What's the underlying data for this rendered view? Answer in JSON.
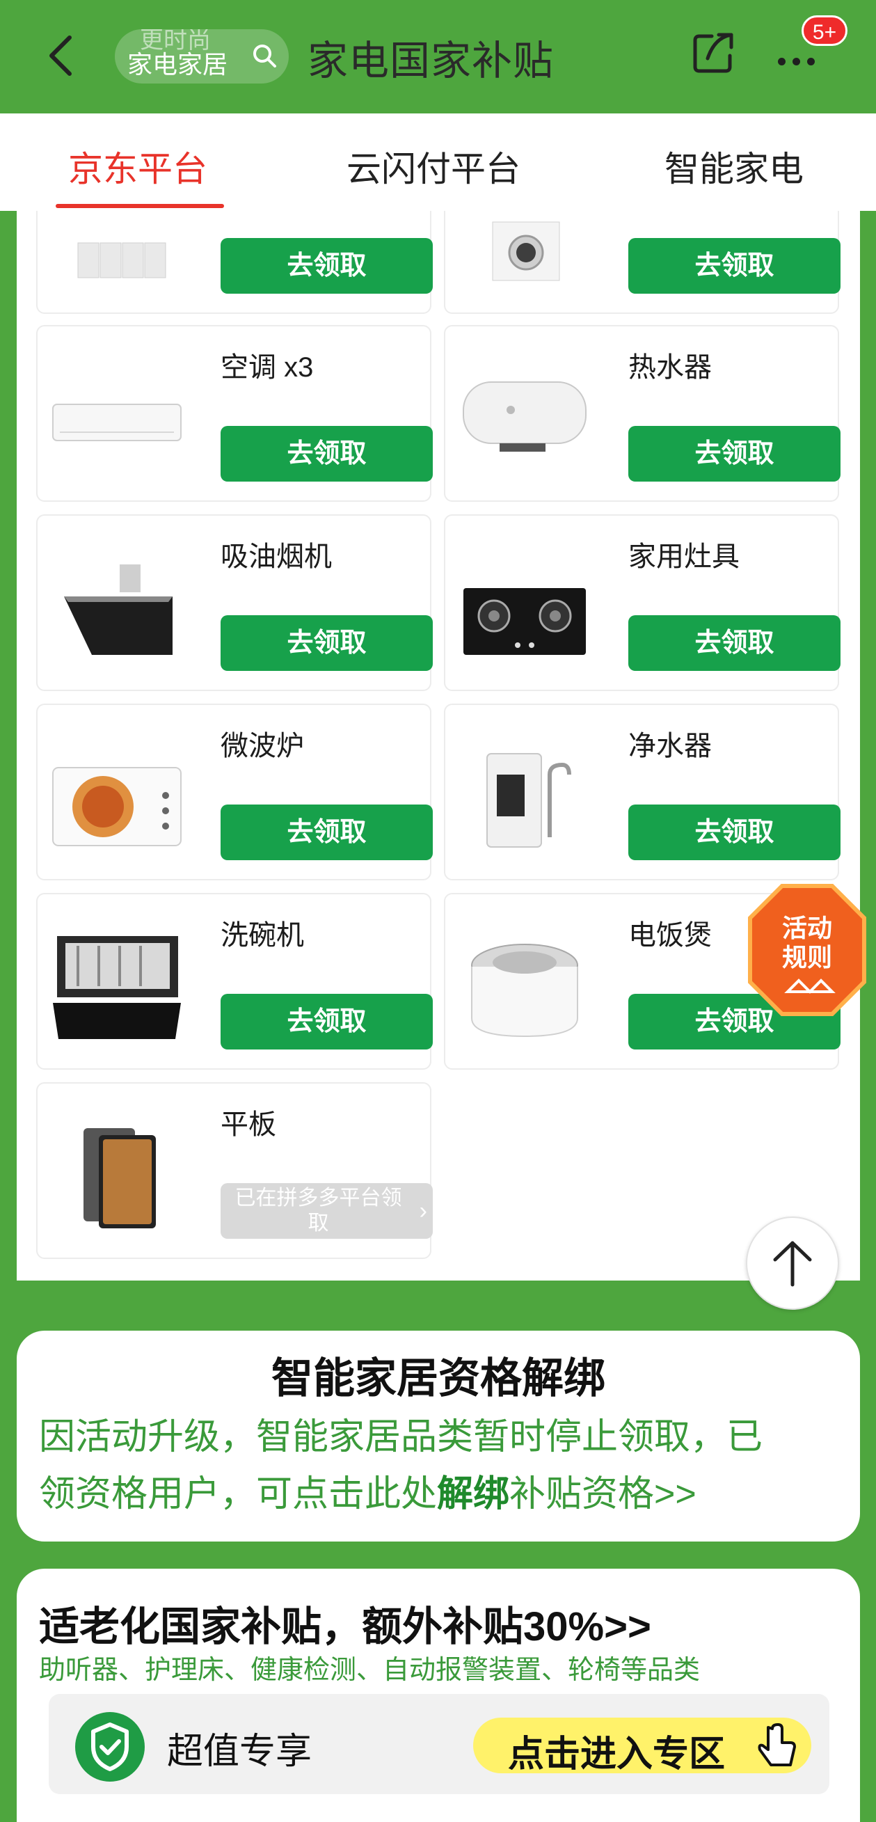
{
  "header": {
    "back_icon": "chevron-left-icon",
    "search_ghost": "更时尚",
    "search_text": "家电家居",
    "title": "家电国家补贴",
    "badge": "5+"
  },
  "tabs": [
    {
      "label": "京东平台",
      "active": true
    },
    {
      "label": "云闪付平台",
      "active": false
    },
    {
      "label": "智能家电",
      "active": false
    }
  ],
  "products": [
    {
      "name": "",
      "button": "去领取"
    },
    {
      "name": "",
      "button": "去领取"
    },
    {
      "name": "空调 x3",
      "button": "去领取"
    },
    {
      "name": "热水器",
      "button": "去领取"
    },
    {
      "name": "吸油烟机",
      "button": "去领取"
    },
    {
      "name": "家用灶具",
      "button": "去领取"
    },
    {
      "name": "微波炉",
      "button": "去领取"
    },
    {
      "name": "净水器",
      "button": "去领取"
    },
    {
      "name": "洗碗机",
      "button": "去领取"
    },
    {
      "name": "电饭煲",
      "button": "去领取"
    },
    {
      "name": "平板",
      "button": "已在拼多多平台领取",
      "disabled": true
    }
  ],
  "rules_float": {
    "line1": "活动",
    "line2": "规则"
  },
  "notice": {
    "title": "智能家居资格解绑",
    "line1": "因活动升级，智能家居品类暂时停止领取，已",
    "line2_pre": "领资格用户，可点击此处",
    "line2_bold": "解绑",
    "line2_post": "补贴资格>>"
  },
  "elder": {
    "title": "适老化国家补贴，额外补贴30%>>",
    "subtitle": "助听器、护理床、健康检测、自动报警装置、轮椅等品类",
    "badge_label": "超值专享",
    "cta": "点击进入专区"
  },
  "colors": {
    "brand_green": "#4ea63e",
    "button_green": "#17a14b",
    "tab_red": "#e8332a"
  }
}
